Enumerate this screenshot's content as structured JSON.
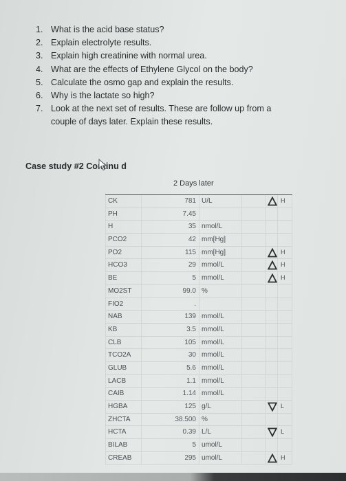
{
  "questions": [
    {
      "num": "1.",
      "text": "What is the acid base status?"
    },
    {
      "num": "2.",
      "text": "Explain electrolyte results."
    },
    {
      "num": "3.",
      "text": "Explain high creatinine with normal urea."
    },
    {
      "num": "4.",
      "text": "What are the effects of Ethylene Glycol on the body?"
    },
    {
      "num": "5.",
      "text": "Calculate the osmo gap and explain the results."
    },
    {
      "num": "6.",
      "text": "Why is the lactate so high?"
    },
    {
      "num": "7.",
      "text": "Look at the next set of results.  These are follow up from a couple of days later.  Explain these results."
    }
  ],
  "case_title": "Case study #2  Continu  d",
  "table_caption": "2 Days later",
  "lab_results": [
    {
      "name": "CK",
      "value": "781",
      "unit": "U/L",
      "flag": "H"
    },
    {
      "name": "PH",
      "value": "7.45",
      "unit": "",
      "flag": ""
    },
    {
      "name": "H",
      "value": "35",
      "unit": "nmol/L",
      "flag": ""
    },
    {
      "name": "PCO2",
      "value": "42",
      "unit": "mm[Hg]",
      "flag": ""
    },
    {
      "name": "PO2",
      "value": "115",
      "unit": "mm[Hg]",
      "flag": "H"
    },
    {
      "name": "HCO3",
      "value": "29",
      "unit": "mmol/L",
      "flag": "H"
    },
    {
      "name": "BE",
      "value": "5",
      "unit": "mmol/L",
      "flag": "H"
    },
    {
      "name": "MO2ST",
      "value": "99.0",
      "unit": "%",
      "flag": ""
    },
    {
      "name": "FIO2",
      "value": ".",
      "unit": "",
      "flag": ""
    },
    {
      "name": "NAB",
      "value": "139",
      "unit": "mmol/L",
      "flag": ""
    },
    {
      "name": "KB",
      "value": "3.5",
      "unit": "mmol/L",
      "flag": ""
    },
    {
      "name": "CLB",
      "value": "105",
      "unit": "mmol/L",
      "flag": ""
    },
    {
      "name": "TCO2A",
      "value": "30",
      "unit": "mmol/L",
      "flag": ""
    },
    {
      "name": "GLUB",
      "value": "5.6",
      "unit": "mmol/L",
      "flag": ""
    },
    {
      "name": "LACB",
      "value": "1.1",
      "unit": "mmol/L",
      "flag": ""
    },
    {
      "name": "CAIB",
      "value": "1.14",
      "unit": "mmol/L",
      "flag": ""
    },
    {
      "name": "HGBA",
      "value": "125",
      "unit": "g/L",
      "flag": "L"
    },
    {
      "name": "ZHCTA",
      "value": "38.500",
      "unit": "%",
      "flag": ""
    },
    {
      "name": "HCTA",
      "value": "0.39",
      "unit": "L/L",
      "flag": "L"
    },
    {
      "name": "BILAB",
      "value": "5",
      "unit": "umol/L",
      "flag": ""
    },
    {
      "name": "CREAB",
      "value": "295",
      "unit": "umol/L",
      "flag": "H"
    }
  ],
  "colors": {
    "text": "#2a2d2e",
    "table_text": "#4a4f52",
    "flag_icon": "#2b2d2e"
  }
}
